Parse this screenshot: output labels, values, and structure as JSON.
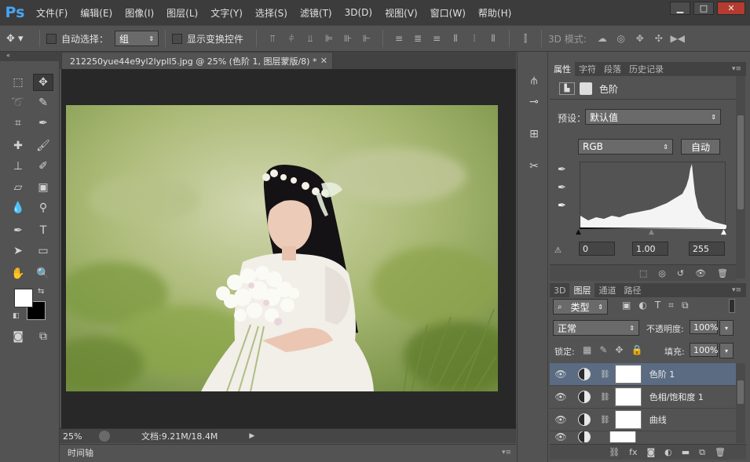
{
  "app": {
    "logo": "Ps"
  },
  "menu": [
    "文件(F)",
    "编辑(E)",
    "图像(I)",
    "图层(L)",
    "文字(Y)",
    "选择(S)",
    "滤镜(T)",
    "3D(D)",
    "视图(V)",
    "窗口(W)",
    "帮助(H)"
  ],
  "options_bar": {
    "auto_select_label": "自动选择：",
    "auto_select_value": "组",
    "show_transform_label": "显示变换控件",
    "mode_3d_label": "3D 模式:"
  },
  "document": {
    "tab_title": "212250yue44e9yl2lypll5.jpg @ 25% (色阶 1, 图层蒙版/8) *",
    "zoom": "25%",
    "doc_info": "文档:9.21M/18.4M",
    "timeline_label": "时间轴"
  },
  "properties": {
    "tabs": [
      "属性",
      "字符",
      "段落",
      "历史记录"
    ],
    "panel_title": "色阶",
    "preset_label": "预设：",
    "preset_value": "默认值",
    "channel_value": "RGB",
    "auto_button": "自动",
    "input_black": "0",
    "input_gamma": "1.00",
    "input_white": "255"
  },
  "layers": {
    "tabs": [
      "3D",
      "图层",
      "通道",
      "路径"
    ],
    "filter_label": "类型",
    "blend_mode": "正常",
    "opacity_label": "不透明度:",
    "opacity_value": "100%",
    "lock_label": "锁定:",
    "fill_label": "填充:",
    "fill_value": "100%",
    "items": [
      {
        "name": "色阶 1"
      },
      {
        "name": "色相/饱和度 1"
      },
      {
        "name": "曲线"
      },
      {
        "name": ""
      }
    ]
  },
  "colors": {
    "accent": "#45a5f5",
    "selected_layer": "#5a6b82",
    "close": "#b43b30"
  }
}
